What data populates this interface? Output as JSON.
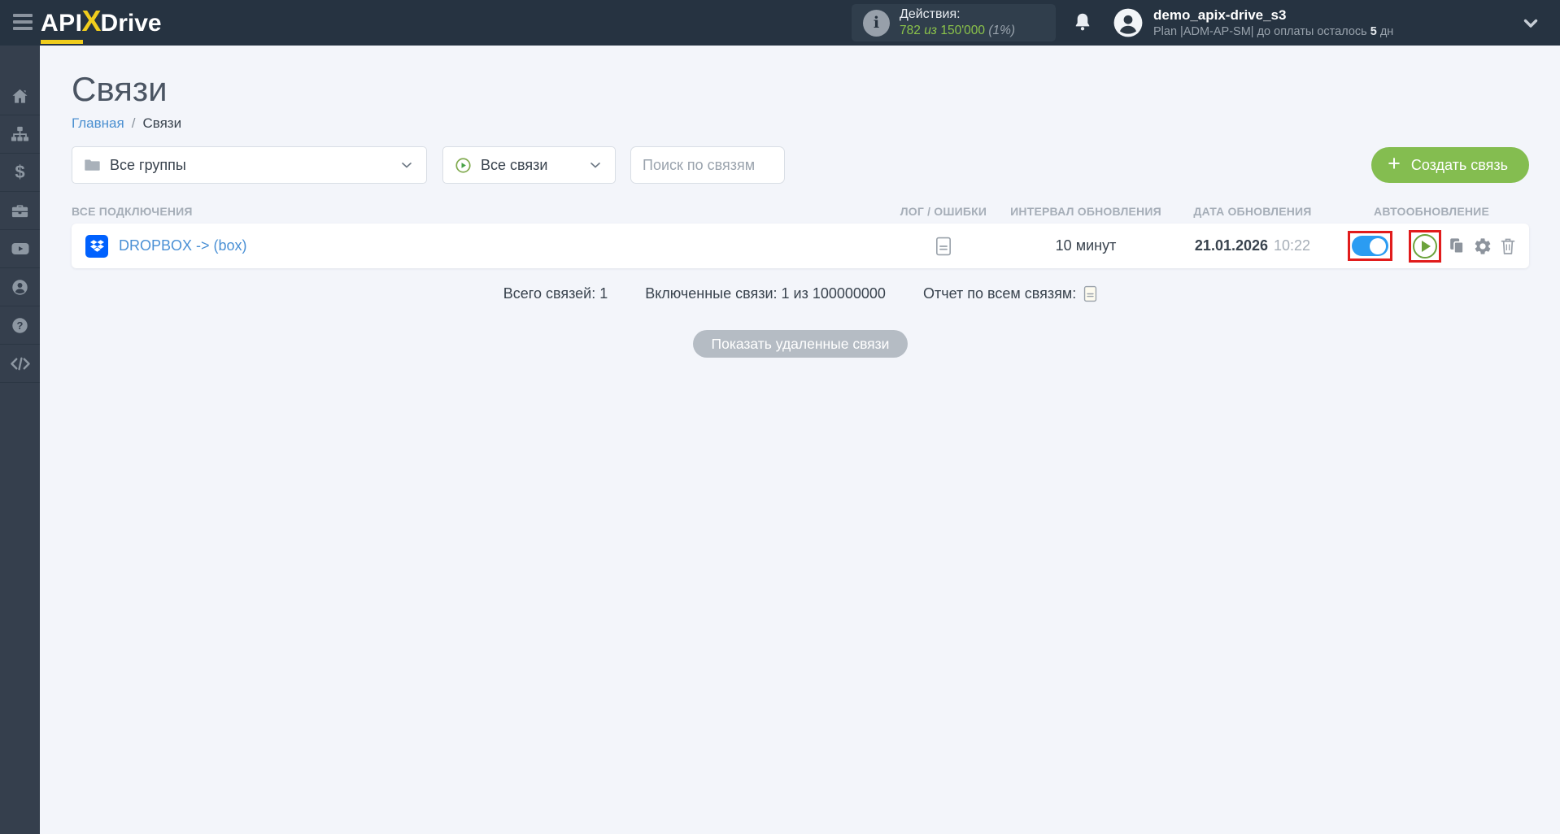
{
  "colors": {
    "topbar_bg": "#263341",
    "sidebar_bg": "#353f4d",
    "page_bg": "#f3f5fa",
    "accent_green": "#84bd50",
    "counter_green": "#8bc34a",
    "link_blue": "#4a90d5",
    "toggle_blue": "#2b9cf2",
    "annotation_red": "#e11c1c",
    "dropbox_blue": "#0061fe"
  },
  "topbar": {
    "logo": {
      "part1": "API",
      "part2": "X",
      "part3": "Drive"
    },
    "actions": {
      "label": "Действия:",
      "used": "782",
      "of_word": "из",
      "limit": "150'000",
      "percent": "(1%)"
    },
    "user": {
      "name": "demo_apix-drive_s3",
      "plan_prefix": "Plan |ADM-AP-SM| до оплаты осталось",
      "days": "5",
      "days_suffix": "дн"
    }
  },
  "sidebar": {
    "items": [
      {
        "icon": "home-icon"
      },
      {
        "icon": "connections-icon"
      },
      {
        "icon": "billing-icon"
      },
      {
        "icon": "briefcase-icon"
      },
      {
        "icon": "video-icon"
      },
      {
        "icon": "account-icon"
      },
      {
        "icon": "help-icon"
      },
      {
        "icon": "code-icon"
      }
    ]
  },
  "page": {
    "title": "Связи",
    "breadcrumb": {
      "home": "Главная",
      "sep": "/",
      "current": "Связи"
    },
    "filters": {
      "groups_dropdown": "Все группы",
      "links_dropdown": "Все связи",
      "search_placeholder": "Поиск по связям",
      "create_plus": "+",
      "create_button": "Создать связь"
    },
    "table": {
      "headers": [
        "ВСЕ ПОДКЛЮЧЕНИЯ",
        "ЛОГ / ОШИБКИ",
        "ИНТЕРВАЛ ОБНОВЛЕНИЯ",
        "ДАТА ОБНОВЛЕНИЯ",
        "АВТООБНОВЛЕНИЕ"
      ],
      "rows": [
        {
          "name": "DROPBOX -> (box)",
          "interval": "10 минут",
          "date": "21.01.2026",
          "time": "10:22",
          "autoupdate_on": true
        }
      ]
    },
    "summary": {
      "total": "Всего связей: 1",
      "enabled": "Включенные связи: 1 из 100000000",
      "report_label": "Отчет по всем связям:"
    },
    "show_deleted_button": "Показать удаленные связи"
  }
}
